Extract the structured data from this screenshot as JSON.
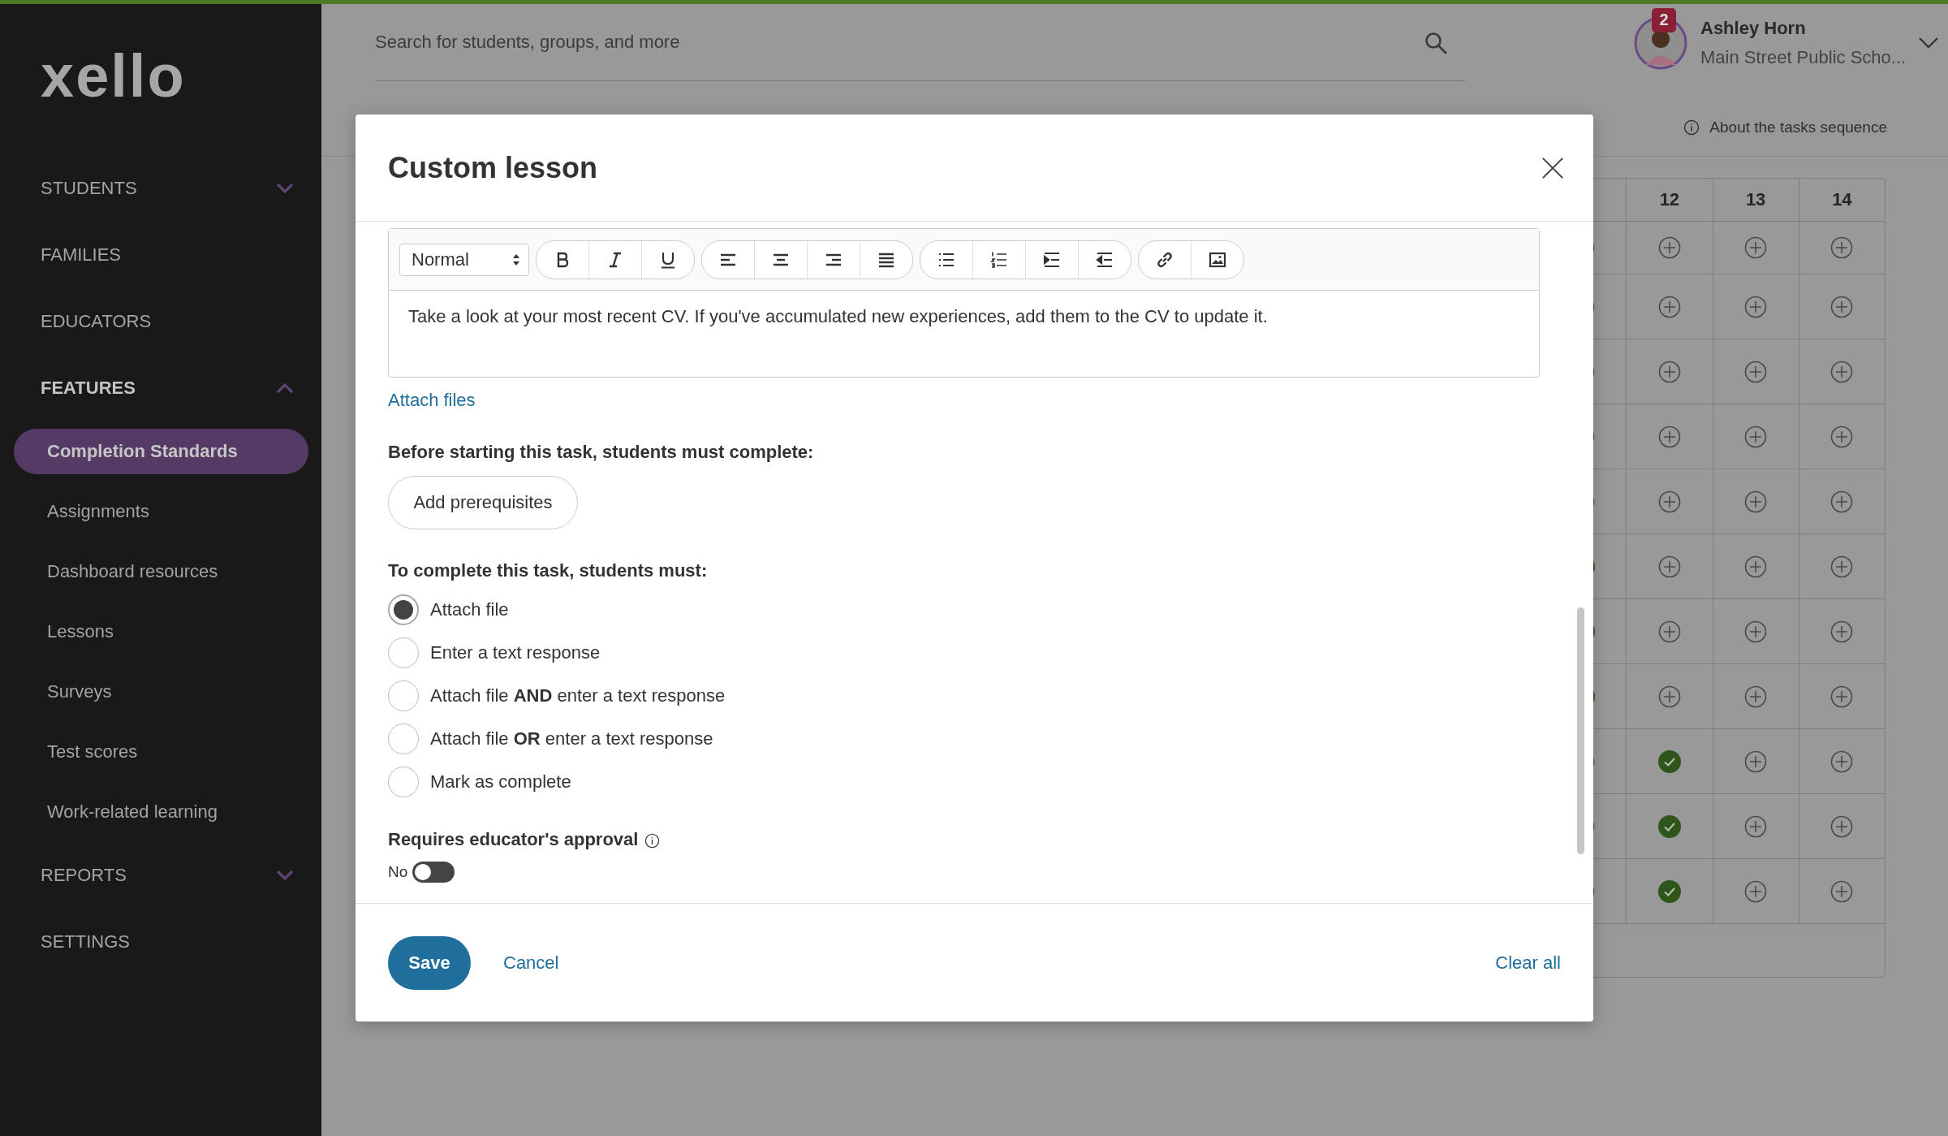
{
  "sidebar": {
    "logo": "xello",
    "items": [
      {
        "label": "STUDENTS",
        "kind": "section",
        "expanded": false
      },
      {
        "label": "FAMILIES",
        "kind": "link"
      },
      {
        "label": "EDUCATORS",
        "kind": "link"
      },
      {
        "label": "FEATURES",
        "kind": "section",
        "expanded": true,
        "children": [
          {
            "label": "Completion Standards",
            "selected": true
          },
          {
            "label": "Assignments",
            "selected": false
          },
          {
            "label": "Dashboard resources",
            "selected": false
          },
          {
            "label": "Lessons",
            "selected": false
          },
          {
            "label": "Surveys",
            "selected": false
          },
          {
            "label": "Test scores",
            "selected": false
          },
          {
            "label": "Work-related learning",
            "selected": false
          }
        ]
      },
      {
        "label": "REPORTS",
        "kind": "section",
        "expanded": false
      },
      {
        "label": "SETTINGS",
        "kind": "link"
      }
    ]
  },
  "header": {
    "search": {
      "placeholder": "Search for students, groups, and more"
    },
    "user": {
      "badge": "2",
      "name": "Ashley Horn",
      "school": "Main Street Public Scho..."
    },
    "about_link": "About the tasks sequence"
  },
  "grid": {
    "columns": [
      "12",
      "13",
      "14"
    ],
    "rows": [
      {
        "cells": [
          {
            "kind": "add"
          },
          {
            "kind": "add"
          },
          {
            "kind": "add"
          },
          {
            "kind": "add"
          }
        ]
      },
      {
        "cells": [
          {
            "kind": "add"
          },
          {
            "kind": "add"
          },
          {
            "kind": "add"
          },
          {
            "kind": "add"
          }
        ]
      },
      {
        "cells": [
          {
            "kind": "add"
          },
          {
            "kind": "add"
          },
          {
            "kind": "add"
          },
          {
            "kind": "add"
          }
        ]
      },
      {
        "cells": [
          {
            "kind": "add"
          },
          {
            "kind": "add"
          },
          {
            "kind": "add"
          },
          {
            "kind": "add"
          }
        ]
      },
      {
        "cells": [
          {
            "kind": "add"
          },
          {
            "kind": "add"
          },
          {
            "kind": "add"
          },
          {
            "kind": "add"
          }
        ]
      },
      {
        "cells": [
          {
            "kind": "done"
          },
          {
            "kind": "add"
          },
          {
            "kind": "add"
          },
          {
            "kind": "add"
          }
        ]
      },
      {
        "cells": [
          {
            "kind": "done"
          },
          {
            "kind": "add"
          },
          {
            "kind": "add"
          },
          {
            "kind": "add"
          }
        ]
      },
      {
        "cells": [
          {
            "kind": "done"
          },
          {
            "kind": "add"
          },
          {
            "kind": "add"
          },
          {
            "kind": "add"
          }
        ]
      },
      {
        "cells": [
          {
            "kind": "add"
          },
          {
            "kind": "done"
          },
          {
            "kind": "add"
          },
          {
            "kind": "add"
          }
        ]
      },
      {
        "cells": [
          {
            "kind": "add"
          },
          {
            "kind": "done"
          },
          {
            "kind": "add"
          },
          {
            "kind": "add"
          }
        ]
      },
      {
        "cells": [
          {
            "kind": "add"
          },
          {
            "kind": "done"
          },
          {
            "kind": "add"
          },
          {
            "kind": "add"
          }
        ]
      }
    ]
  },
  "dialog": {
    "title": "Custom lesson",
    "editor": {
      "format": "Normal",
      "text": "Take a look at your most recent CV. If you've accumulated new experiences, add them to the CV to update it."
    },
    "attach_link": "Attach files",
    "prerequisites": {
      "label": "Before starting this task, students must complete:",
      "button": "Add prerequisites"
    },
    "completion": {
      "label": "To complete this task, students must:",
      "options": [
        {
          "label": "Attach file",
          "selected": true
        },
        {
          "label": "Enter a text response",
          "selected": false
        },
        {
          "label": "Attach file **AND** enter a text response",
          "selected": false
        },
        {
          "label": "Attach file **OR** enter a text response",
          "selected": false
        },
        {
          "label": "Mark as complete",
          "selected": false
        }
      ]
    },
    "approval": {
      "label": "Requires educator's approval",
      "toggle": {
        "label": "No",
        "on": false
      }
    },
    "buttons": {
      "save": "Save",
      "cancel": "Cancel",
      "clear": "Clear all"
    }
  }
}
